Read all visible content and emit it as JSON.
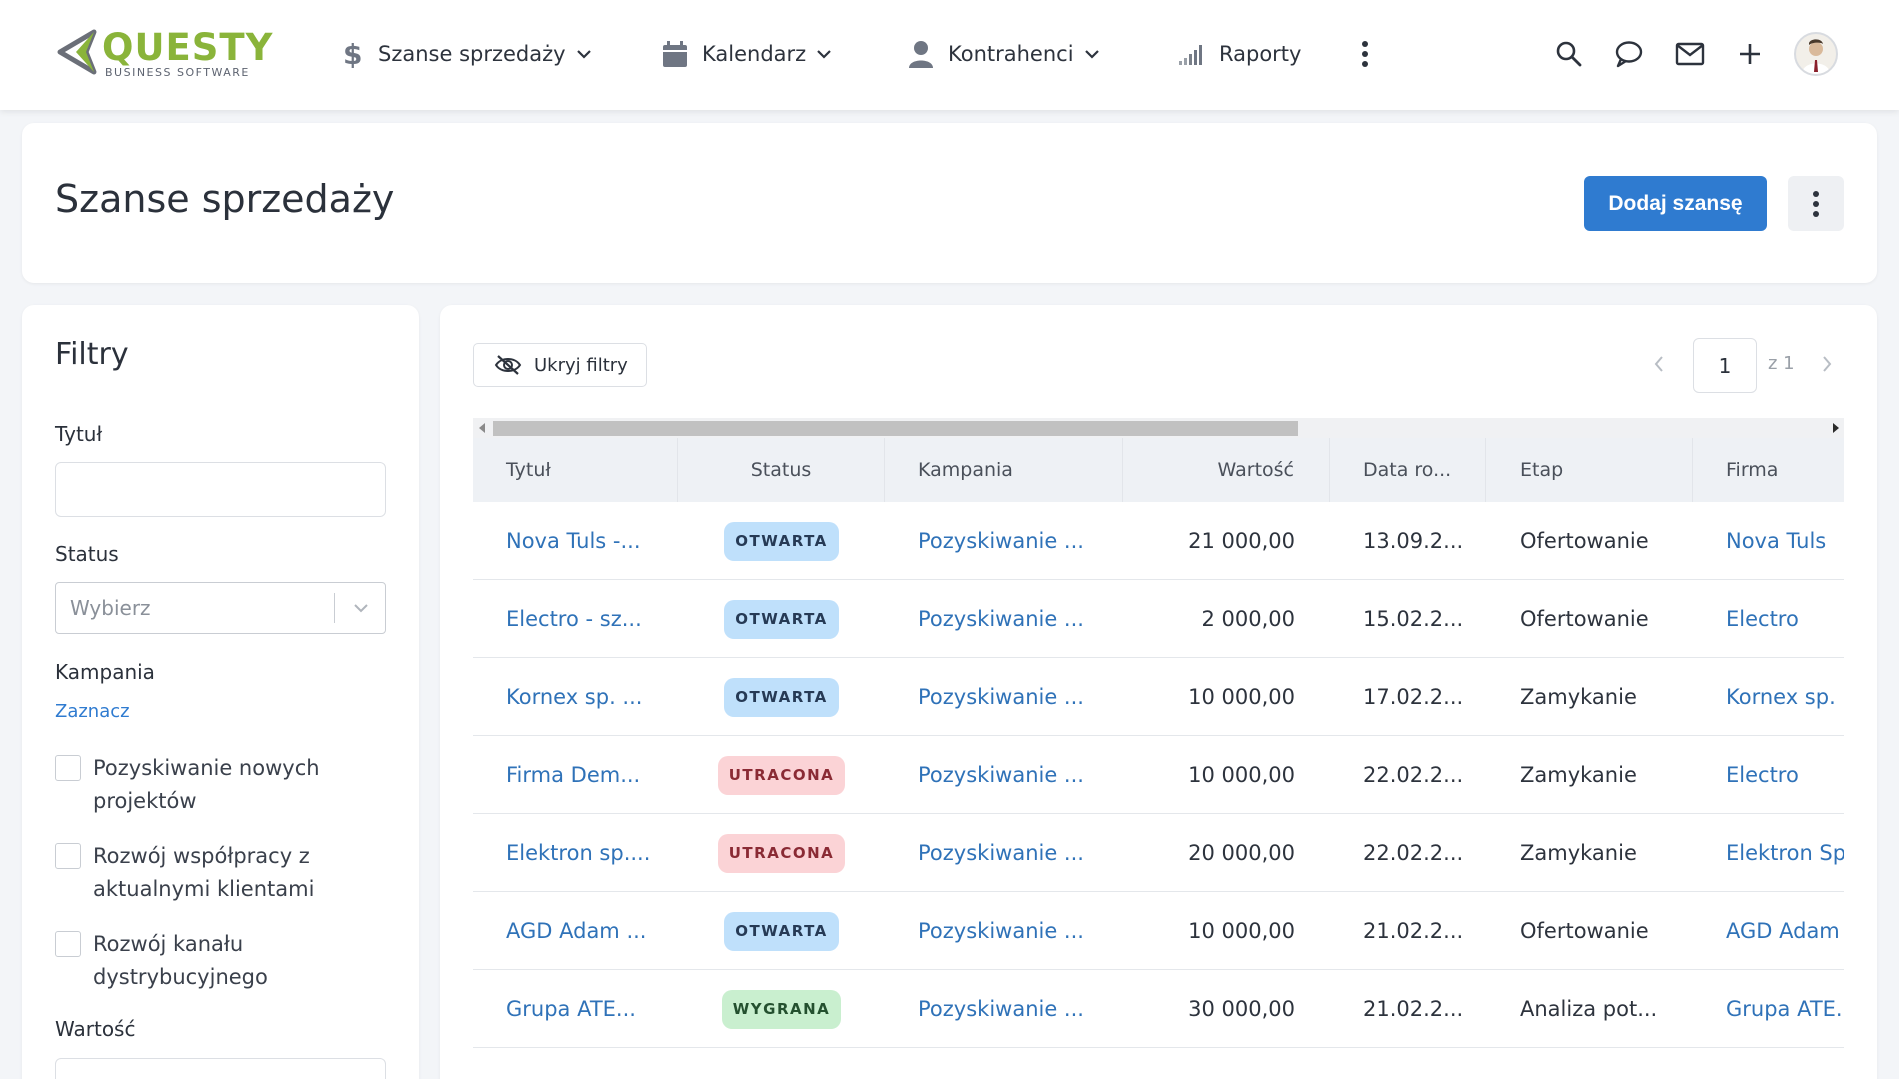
{
  "logo": {
    "name": "QUESTY",
    "tagline": "BUSINESS SOFTWARE"
  },
  "nav": {
    "items": [
      {
        "label": "Szanse sprzedaży",
        "icon": "dollar-icon",
        "has_dropdown": true
      },
      {
        "label": "Kalendarz",
        "icon": "calendar-icon",
        "has_dropdown": true
      },
      {
        "label": "Kontrahenci",
        "icon": "user-icon",
        "has_dropdown": true
      },
      {
        "label": "Raporty",
        "icon": "signal-bars-icon",
        "has_dropdown": false
      }
    ],
    "right_icons": [
      "search-icon",
      "chat-icon",
      "mail-icon",
      "plus-icon",
      "avatar"
    ]
  },
  "header": {
    "title": "Szanse sprzedaży",
    "add_button": "Dodaj szansę"
  },
  "filters": {
    "title": "Filtry",
    "title_field": {
      "label": "Tytuł",
      "value": ""
    },
    "status_field": {
      "label": "Status",
      "placeholder": "Wybierz"
    },
    "campaign": {
      "label": "Kampania",
      "select_link": "Zaznacz",
      "options": [
        {
          "line1": "Pozyskiwanie nowych",
          "line2": "projektów"
        },
        {
          "line1": "Rozwój współpracy z",
          "line2": "aktualnymi klientami"
        },
        {
          "line1": "Rozwój kanału",
          "line2": "dystrybucyjnego"
        }
      ]
    },
    "value_label": "Wartość"
  },
  "toolbar": {
    "hide_filters": "Ukryj filtry"
  },
  "pager": {
    "page": "1",
    "of_text": "z 1"
  },
  "table": {
    "columns": [
      "Tytuł",
      "Status",
      "Kampania",
      "Wartość",
      "Data ro...",
      "Etap",
      "Firma"
    ],
    "rows": [
      {
        "title": "Nova Tuls -...",
        "status": "OTWARTA",
        "status_kind": "open",
        "campaign": "Pozyskiwanie ...",
        "value": "21 000,00",
        "date": "13.09.2...",
        "stage": "Ofertowanie",
        "company": "Nova Tuls"
      },
      {
        "title": "Electro - sz...",
        "status": "OTWARTA",
        "status_kind": "open",
        "campaign": "Pozyskiwanie ...",
        "value": "2 000,00",
        "date": "15.02.2...",
        "stage": "Ofertowanie",
        "company": "Electro"
      },
      {
        "title": "Kornex sp. ...",
        "status": "OTWARTA",
        "status_kind": "open",
        "campaign": "Pozyskiwanie ...",
        "value": "10 000,00",
        "date": "17.02.2...",
        "stage": "Zamykanie",
        "company": "Kornex sp."
      },
      {
        "title": "Firma Dem...",
        "status": "UTRACONA",
        "status_kind": "lost",
        "campaign": "Pozyskiwanie ...",
        "value": "10 000,00",
        "date": "22.02.2...",
        "stage": "Zamykanie",
        "company": "Electro"
      },
      {
        "title": "Elektron sp....",
        "status": "UTRACONA",
        "status_kind": "lost",
        "campaign": "Pozyskiwanie ...",
        "value": "20 000,00",
        "date": "22.02.2...",
        "stage": "Zamykanie",
        "company": "Elektron Sp"
      },
      {
        "title": "AGD Adam ...",
        "status": "OTWARTA",
        "status_kind": "open",
        "campaign": "Pozyskiwanie ...",
        "value": "10 000,00",
        "date": "21.02.2...",
        "stage": "Ofertowanie",
        "company": "AGD Adam"
      },
      {
        "title": "Grupa ATE...",
        "status": "WYGRANA",
        "status_kind": "won",
        "campaign": "Pozyskiwanie ...",
        "value": "30 000,00",
        "date": "21.02.2...",
        "stage": "Analiza pot...",
        "company": "Grupa ATE."
      }
    ]
  },
  "colors": {
    "accent": "#2f7bd0",
    "link": "#2f72b8",
    "logo_green": "#8ab43a",
    "badge_open": "#bfe0fb",
    "badge_lost": "#fbd3d6",
    "badge_won": "#c9efcf"
  }
}
